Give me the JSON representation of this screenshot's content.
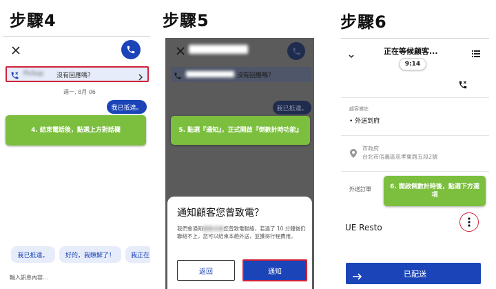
{
  "steps": {
    "s4": "步驟4",
    "s5": "步驟5",
    "s6": "步驟6"
  },
  "panel4": {
    "banner_text": "沒有回應嗎？",
    "banner_prefix_blur": "Pickup",
    "date": "週一, 8月 06",
    "bubble": "我已抵達。",
    "callout": "4. 結束電話後，點選上方對話欄",
    "quick_replies": [
      "我已抵達。",
      "好的，我瞭解了！",
      "我正在"
    ],
    "input_placeholder": "輸入訊息內容..."
  },
  "panel5": {
    "header_blur": "Customer name",
    "banner_text": "沒有回應嗎？",
    "bubble": "我已抵達。",
    "callout": "5. 點選『通知』，正式開啟『倒數計時功能』",
    "dialog_title": "通知顧客您曾致電？",
    "dialog_body_1": "我們會通知",
    "dialog_body_blur": "顧客名稱",
    "dialog_body_2": "您曾致電聯絡，若過了 10 分鐘後仍聯絡不上，您可以結束本趟外送，並獲得行程費用。",
    "back_button": "返回",
    "notify_button": "通知"
  },
  "panel6": {
    "header_title": "正在等候顧客...",
    "timer": "9:14",
    "note_label": "顧客備註",
    "note_item": "外送到府",
    "address_line1": "市政府",
    "address_line2": "台北市信義區忠孝東路五段2號",
    "order_label": "外送訂單",
    "callout": "6. 開啟倒數計時後，點選下方選項",
    "restaurant": "UE Resto",
    "delivered_button": "已配送"
  },
  "colors": {
    "brand_blue": "#1a44b8",
    "callout_green": "#7cbf3f",
    "highlight_red": "#d0223a"
  },
  "icons": [
    "close-icon",
    "phone-icon",
    "missed-call-icon",
    "chevron-right-icon",
    "chevron-down-icon",
    "list-icon",
    "location-pin-icon",
    "more-vert-icon",
    "arrow-right-icon"
  ]
}
